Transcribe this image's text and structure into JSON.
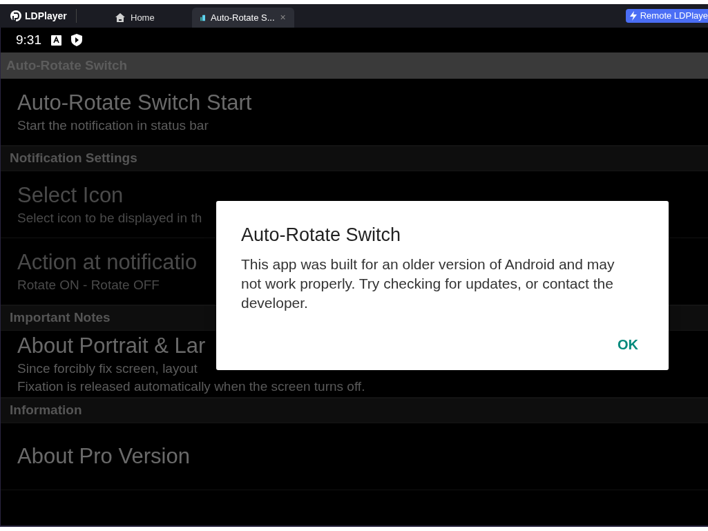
{
  "titlebar": {
    "brand": "LDPlayer",
    "tabs": [
      {
        "label": "Home",
        "kind": "home",
        "selected": false
      },
      {
        "label": "Auto-Rotate S...",
        "kind": "app",
        "selected": true,
        "close": "×"
      }
    ],
    "remote_button": "Remote LDPlaye"
  },
  "status_bar": {
    "time": "9:31"
  },
  "app_bar": {
    "title": "Auto-Rotate Switch"
  },
  "settings": [
    {
      "kind": "item",
      "title": "Auto-Rotate Switch Start",
      "summary": [
        "Start the notification in status bar"
      ],
      "disabled": false
    },
    {
      "kind": "category",
      "title": "Notification Settings"
    },
    {
      "kind": "item",
      "title": "Select Icon",
      "summary": [
        "Select icon to be displayed in th"
      ],
      "disabled": true
    },
    {
      "kind": "item",
      "title": "Action at notificatio",
      "summary": [
        "Rotate ON - Rotate OFF"
      ],
      "disabled": true
    },
    {
      "kind": "category",
      "title": "Important Notes"
    },
    {
      "kind": "item",
      "title": "About Portrait & Lar",
      "summary": [
        "Since forcibly fix screen, layout",
        "Fixation is released automatically when the screen turns off."
      ],
      "disabled": false
    },
    {
      "kind": "category",
      "title": "Information"
    },
    {
      "kind": "item",
      "title": "About Pro Version",
      "disabled": false
    }
  ],
  "dialog": {
    "title": "Auto-Rotate Switch",
    "message": "This app was built for an older version of Android and may not work properly. Try checking for updates, or contact the developer.",
    "button": "OK"
  }
}
